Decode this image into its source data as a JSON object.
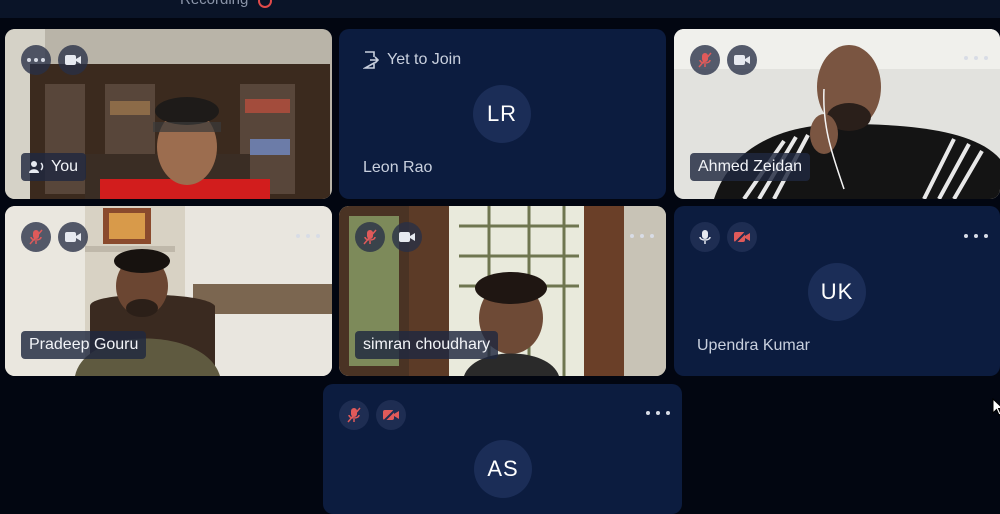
{
  "meeting": {
    "recording_label": "Recording",
    "join_status_label": "Yet to Join"
  },
  "participants": [
    {
      "name": "You"
    },
    {
      "name": "Leon Rao",
      "initials": "LR"
    },
    {
      "name": "Ahmed Zeidan"
    },
    {
      "name": "Pradeep Gouru"
    },
    {
      "name": "simran choudhary"
    },
    {
      "name": "Upendra Kumar",
      "initials": "UK"
    },
    {
      "initials": "AS"
    }
  ],
  "icons": {
    "more": "more-options-icon",
    "camera": "camera-icon",
    "camera_off": "camera-off-icon",
    "mic": "mic-icon",
    "mic_off": "mic-off-icon",
    "speaker": "speaking-icon",
    "exit": "door-exit-icon",
    "recording": "recording-dot-icon"
  },
  "colors": {
    "tile_bg": "#0c1c3f",
    "mute_red": "#e05a5a",
    "page_bg": "#020611"
  }
}
